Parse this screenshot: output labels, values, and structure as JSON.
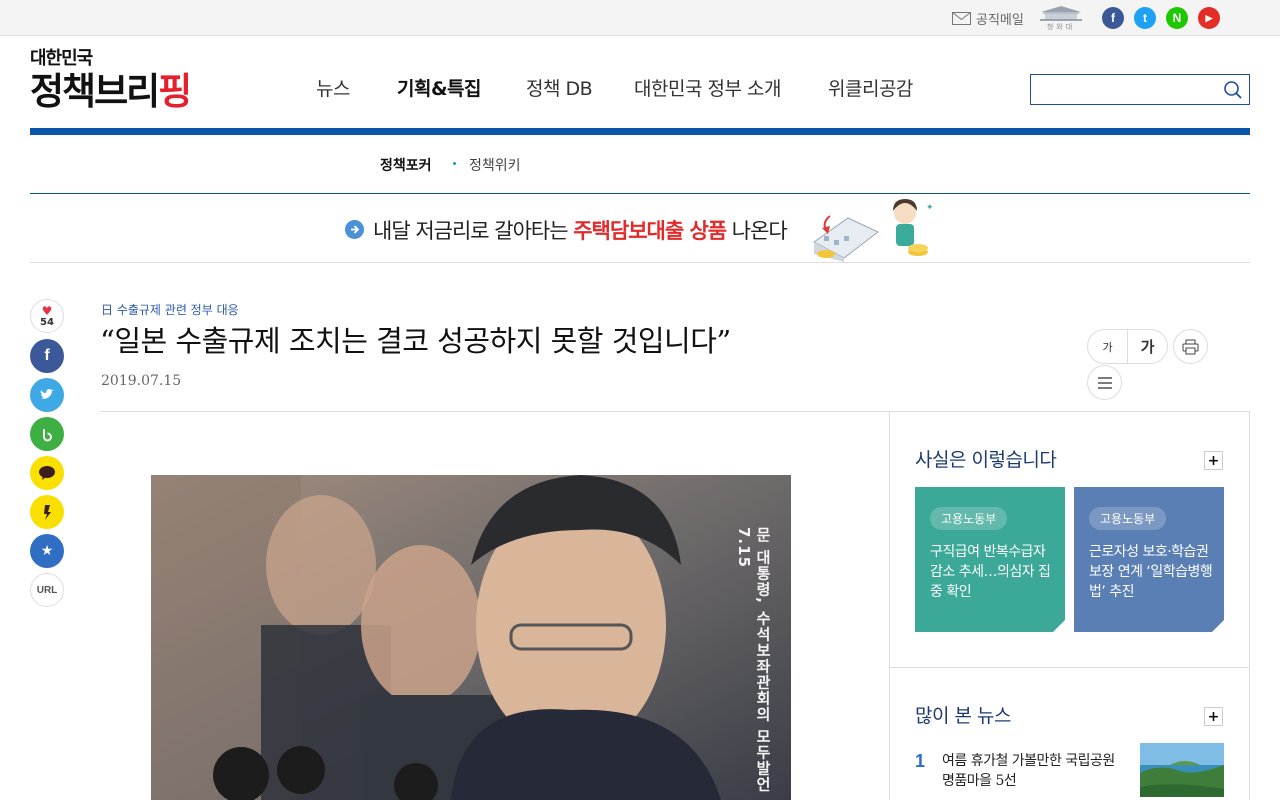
{
  "utility": {
    "mail_label": "공직메일",
    "cheongwadae_label": "청와대"
  },
  "sns_top": [
    {
      "name": "facebook",
      "glyph": "f",
      "color": "#3b5998"
    },
    {
      "name": "twitter",
      "glyph": "t",
      "color": "#1da1f2"
    },
    {
      "name": "naver",
      "glyph": "N",
      "color": "#1ec800"
    },
    {
      "name": "youtube",
      "glyph": "▶",
      "color": "#e52d27"
    }
  ],
  "logo": {
    "top": "대한민국",
    "bottom_part1": "정책브리",
    "bottom_part2": "핑"
  },
  "gnb": [
    "뉴스",
    "기획&특집",
    "정책 DB",
    "대한민국 정부 소개",
    "위클리공감"
  ],
  "search": {
    "value": "",
    "placeholder": ""
  },
  "subnav": [
    "정책포커",
    "정책위키"
  ],
  "banner": {
    "text1": "내달 저금리로 갈아타는 ",
    "text_red": "주택담보대출 상품",
    "text2": " 나온다"
  },
  "share": {
    "like_count": "54",
    "url_label": "URL"
  },
  "article": {
    "category": "日 수출규제 관련 정부 대응",
    "headline": "“일본 수출규제 조치는 결코 성공하지 못할 것입니다”",
    "date": "2019.07.15",
    "photo_caption": "문 대통령, 수석보좌관회의 모두발언 7.15"
  },
  "tools": {
    "font_small": "가",
    "font_large": "가"
  },
  "sidebar": {
    "facts_title": "사실은 이렇습니다",
    "facts": [
      {
        "tag": "고용노동부",
        "text": "구직급여 반복수급자 감소 추세…의심자 집중 확인",
        "color": "#3ba898"
      },
      {
        "tag": "고용노동부",
        "text": "근로자성 보호·학습권 보장 연계 ‘일학습병행법’ 추진",
        "color": "#5a7fb5"
      }
    ],
    "popular_title": "많이 본 뉴스",
    "popular": [
      {
        "rank": "1",
        "title": "여름 휴가철 가볼만한 국립공원 명품마을 5선"
      }
    ]
  },
  "colors": {
    "brand_blue": "#0a56a8",
    "accent_red": "#e5202d"
  }
}
